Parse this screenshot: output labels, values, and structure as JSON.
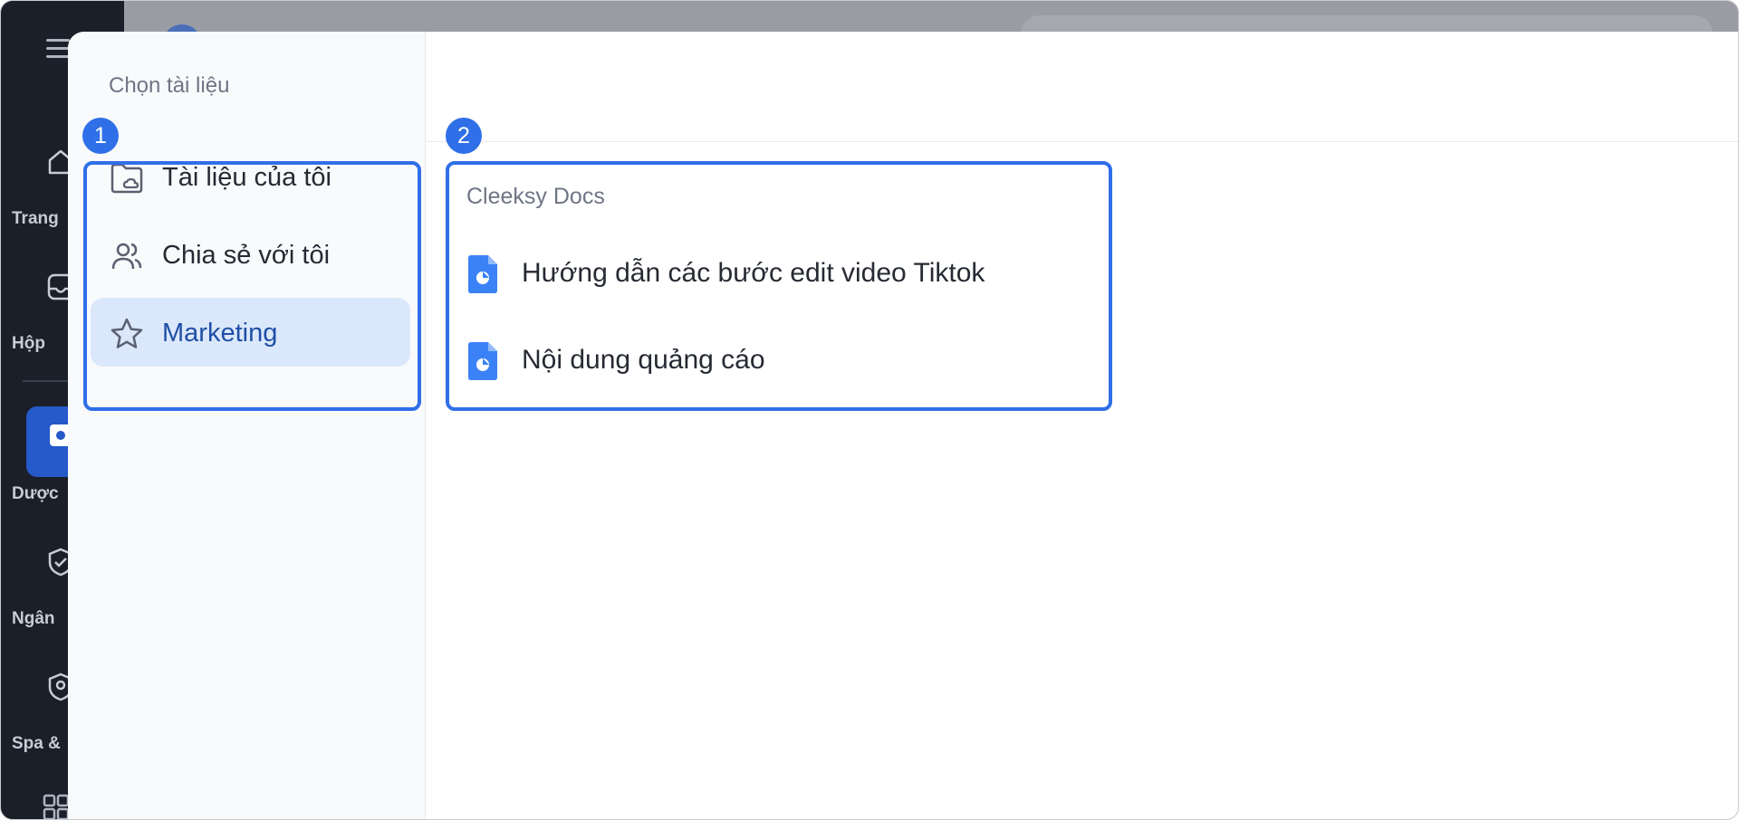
{
  "rail": {
    "items": [
      {
        "label": "Trang",
        "icon": "home-icon"
      },
      {
        "label": "Hộp",
        "icon": "inbox-icon"
      },
      {
        "label": "Dược",
        "icon": "puzzle-icon"
      },
      {
        "label": "Ngân",
        "icon": "shield-check-icon"
      },
      {
        "label": "Spa &",
        "icon": "user-badge-icon"
      }
    ]
  },
  "modal": {
    "title": "Chọn tài liệu",
    "nav": [
      {
        "label": "Tài liệu của tôi",
        "icon": "folder-cloud-icon",
        "active": false
      },
      {
        "label": "Chia sẻ với tôi",
        "icon": "users-icon",
        "active": false
      },
      {
        "label": "Marketing",
        "icon": "star-icon",
        "active": true
      }
    ],
    "docs_section": "Cleeksy Docs",
    "docs": [
      {
        "label": "Hướng dẫn các bước edit video Tiktok",
        "icon": "doc-file-icon"
      },
      {
        "label": "Nội dung quảng cáo",
        "icon": "doc-file-icon"
      }
    ]
  },
  "annotations": [
    {
      "number": "1"
    },
    {
      "number": "2"
    }
  ],
  "colors": {
    "accent": "#2f6fe8",
    "active_bg": "#dbe8fb",
    "active_text": "#1f4fa6",
    "rail_bg": "#1b1f2a",
    "doc_icon": "#3b82f6"
  }
}
